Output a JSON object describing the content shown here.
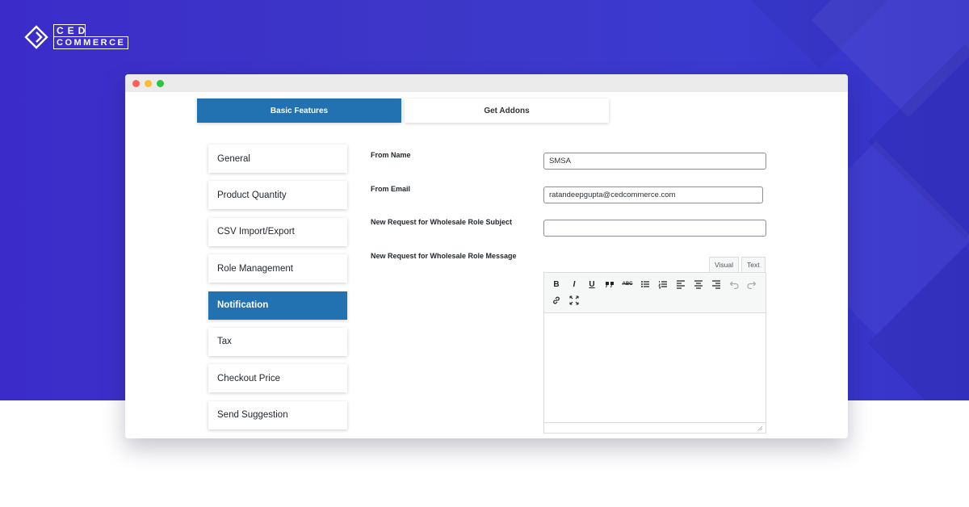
{
  "brand": {
    "line1": "CED",
    "line2": "COMMERCE"
  },
  "tabs": [
    {
      "label": "Basic Features",
      "active": true
    },
    {
      "label": "Get Addons",
      "active": false
    }
  ],
  "sidebar": {
    "items": [
      {
        "label": "General"
      },
      {
        "label": "Product Quantity"
      },
      {
        "label": "CSV Import/Export"
      },
      {
        "label": "Role Management"
      },
      {
        "label": "Notification",
        "active": true
      },
      {
        "label": "Tax"
      },
      {
        "label": "Checkout Price"
      },
      {
        "label": "Send Suggestion"
      }
    ]
  },
  "form": {
    "from_name": {
      "label": "From Name",
      "value": "SMSA"
    },
    "from_email": {
      "label": "From Email",
      "value": "ratandeepgupta@cedcommerce.com"
    },
    "subject": {
      "label": "New Request for Wholesale Role Subject",
      "value": ""
    },
    "message": {
      "label": "New Request for Wholesale Role Message"
    }
  },
  "editor": {
    "tabs": {
      "visual": "Visual",
      "text": "Text"
    },
    "bold": "B",
    "italic": "I",
    "underline": "U",
    "strike": "ABC"
  },
  "colors": {
    "accent": "#2271b1",
    "banner": "#3b36c9",
    "dot_red": "#ff5f57",
    "dot_yellow": "#febc2e",
    "dot_green": "#28c840"
  }
}
